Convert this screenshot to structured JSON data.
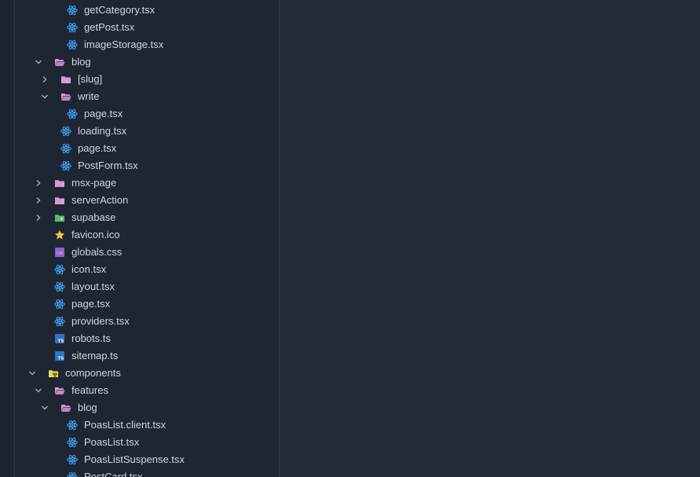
{
  "explorer": {
    "rows": [
      {
        "label": "getCategory.tsx",
        "icon": "react-icon",
        "depth": 4,
        "chevron": "none"
      },
      {
        "label": "getPost.tsx",
        "icon": "react-icon",
        "depth": 4,
        "chevron": "none"
      },
      {
        "label": "imageStorage.tsx",
        "icon": "react-icon",
        "depth": 4,
        "chevron": "none"
      },
      {
        "label": "blog",
        "icon": "folder-open-icon",
        "depth": 2,
        "chevron": "down"
      },
      {
        "label": "[slug]",
        "icon": "folder-icon",
        "depth": 3,
        "chevron": "right"
      },
      {
        "label": "write",
        "icon": "folder-open-icon",
        "depth": 3,
        "chevron": "down"
      },
      {
        "label": "page.tsx",
        "icon": "react-icon",
        "depth": 4,
        "chevron": "none"
      },
      {
        "label": "loading.tsx",
        "icon": "react-icon",
        "depth": 3,
        "chevron": "none"
      },
      {
        "label": "page.tsx",
        "icon": "react-icon",
        "depth": 3,
        "chevron": "none"
      },
      {
        "label": "PostForm.tsx",
        "icon": "react-icon",
        "depth": 3,
        "chevron": "none"
      },
      {
        "label": "msx-page",
        "icon": "folder-icon",
        "depth": 2,
        "chevron": "right"
      },
      {
        "label": "serverAction",
        "icon": "folder-icon",
        "depth": 2,
        "chevron": "right"
      },
      {
        "label": "supabase",
        "icon": "supabase-folder-icon",
        "depth": 2,
        "chevron": "right"
      },
      {
        "label": "favicon.ico",
        "icon": "star-icon",
        "depth": 2,
        "chevron": "none"
      },
      {
        "label": "globals.css",
        "icon": "css-icon",
        "depth": 2,
        "chevron": "none"
      },
      {
        "label": "icon.tsx",
        "icon": "react-icon",
        "depth": 2,
        "chevron": "none"
      },
      {
        "label": "layout.tsx",
        "icon": "react-icon",
        "depth": 2,
        "chevron": "none"
      },
      {
        "label": "page.tsx",
        "icon": "react-icon",
        "depth": 2,
        "chevron": "none"
      },
      {
        "label": "providers.tsx",
        "icon": "react-icon",
        "depth": 2,
        "chevron": "none"
      },
      {
        "label": "robots.ts",
        "icon": "typescript-icon",
        "depth": 2,
        "chevron": "none"
      },
      {
        "label": "sitemap.ts",
        "icon": "typescript-icon",
        "depth": 2,
        "chevron": "none"
      },
      {
        "label": "components",
        "icon": "components-folder-icon",
        "depth": 1,
        "chevron": "down"
      },
      {
        "label": "features",
        "icon": "folder-open-icon",
        "depth": 2,
        "chevron": "down"
      },
      {
        "label": "blog",
        "icon": "folder-open-icon",
        "depth": 3,
        "chevron": "down"
      },
      {
        "label": "PoasList.client.tsx",
        "icon": "react-icon",
        "depth": 4,
        "chevron": "none"
      },
      {
        "label": "PoasList.tsx",
        "icon": "react-icon",
        "depth": 4,
        "chevron": "none"
      },
      {
        "label": "PoasListSuspense.tsx",
        "icon": "react-icon",
        "depth": 4,
        "chevron": "none"
      },
      {
        "label": "PostCard.tsx",
        "icon": "react-icon",
        "depth": 4,
        "chevron": "none"
      }
    ]
  },
  "colors": {
    "react": "#3d9be9",
    "folder": "#d79ad6",
    "text": "#cfd6e2",
    "chevron": "#aab2c0",
    "star": "#f3c23d",
    "css": "#8e63c9",
    "typescript": "#2f74c0",
    "supabase": "#5fb86a",
    "components": "#e7d85c"
  }
}
